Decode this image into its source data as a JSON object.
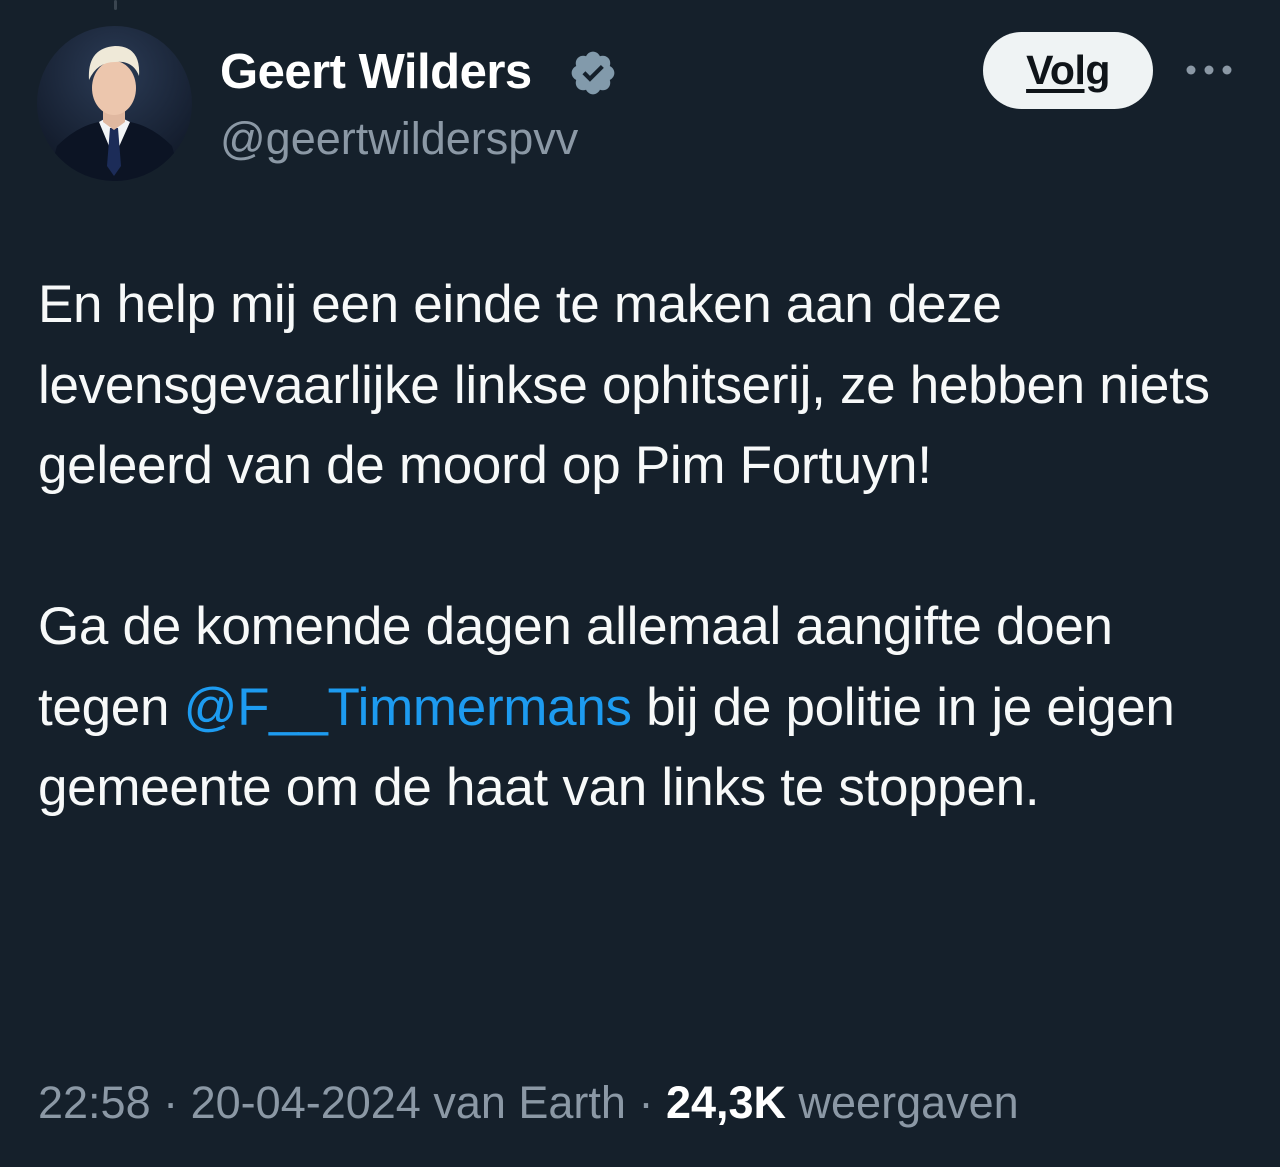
{
  "author": {
    "display_name": "Geert Wilders",
    "handle": "@geertwilderspvv",
    "verified": true
  },
  "actions": {
    "follow_label": "Volg",
    "more_icon": "more-horizontal-icon"
  },
  "tweet": {
    "paragraph1": "En help mij een einde te maken aan deze levensgevaarlijke linkse ophitserij, ze hebben niets geleerd van de moord op Pim Fortuyn!",
    "paragraph2_before": "Ga de komende dagen allemaal aangifte doen tegen ",
    "mention": "@F__Timmermans",
    "paragraph2_after": " bij de politie in je eigen gemeente om de haat van links te stoppen."
  },
  "meta": {
    "time": "22:58",
    "separator1": " · ",
    "date": "20-04-2024",
    "source": " van Earth",
    "separator2": " · ",
    "views_count": "24,3K",
    "views_label": " weergaven"
  },
  "colors": {
    "background": "#15202b",
    "text": "#f7f9f9",
    "secondary_text": "#8b98a5",
    "accent": "#1d9bf0",
    "verified_badge": "#829aab",
    "button_bg": "#eff3f4"
  }
}
